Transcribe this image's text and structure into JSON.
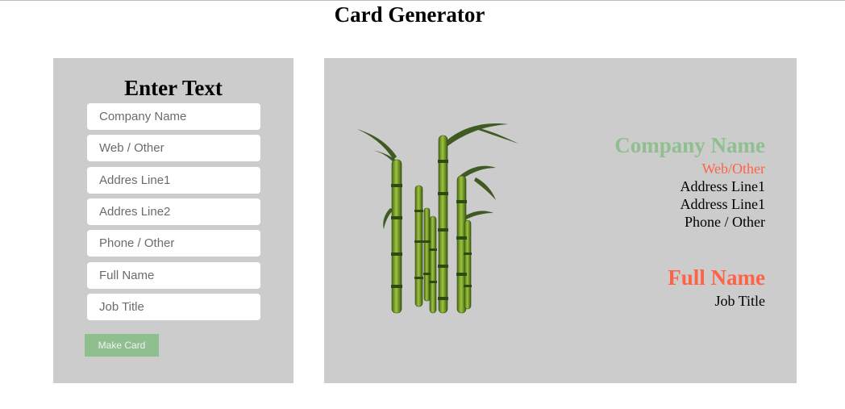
{
  "page": {
    "title": "Card Generator"
  },
  "form": {
    "heading": "Enter Text",
    "fields": [
      {
        "name": "company-name-input",
        "placeholder": "Company Name",
        "value": ""
      },
      {
        "name": "web-other-input",
        "placeholder": "Web / Other",
        "value": ""
      },
      {
        "name": "address-line1-input",
        "placeholder": "Addres Line1",
        "value": ""
      },
      {
        "name": "address-line2-input",
        "placeholder": "Addres Line2",
        "value": ""
      },
      {
        "name": "phone-other-input",
        "placeholder": "Phone / Other",
        "value": ""
      },
      {
        "name": "full-name-input",
        "placeholder": "Full Name",
        "value": ""
      },
      {
        "name": "job-title-input",
        "placeholder": "Job Title",
        "value": ""
      }
    ],
    "submit_label": "Make Card"
  },
  "card": {
    "image": "bamboo-image",
    "company": "Company Name",
    "web": "Web/Other",
    "address_line1": "Address Line1",
    "address_line2": "Address Line1",
    "phone": "Phone / Other",
    "full_name": "Full Name",
    "job_title": "Job Title"
  },
  "colors": {
    "panel_bg": "#cccccc",
    "accent_green": "#8fbf8f",
    "accent_red": "#ff6347"
  }
}
